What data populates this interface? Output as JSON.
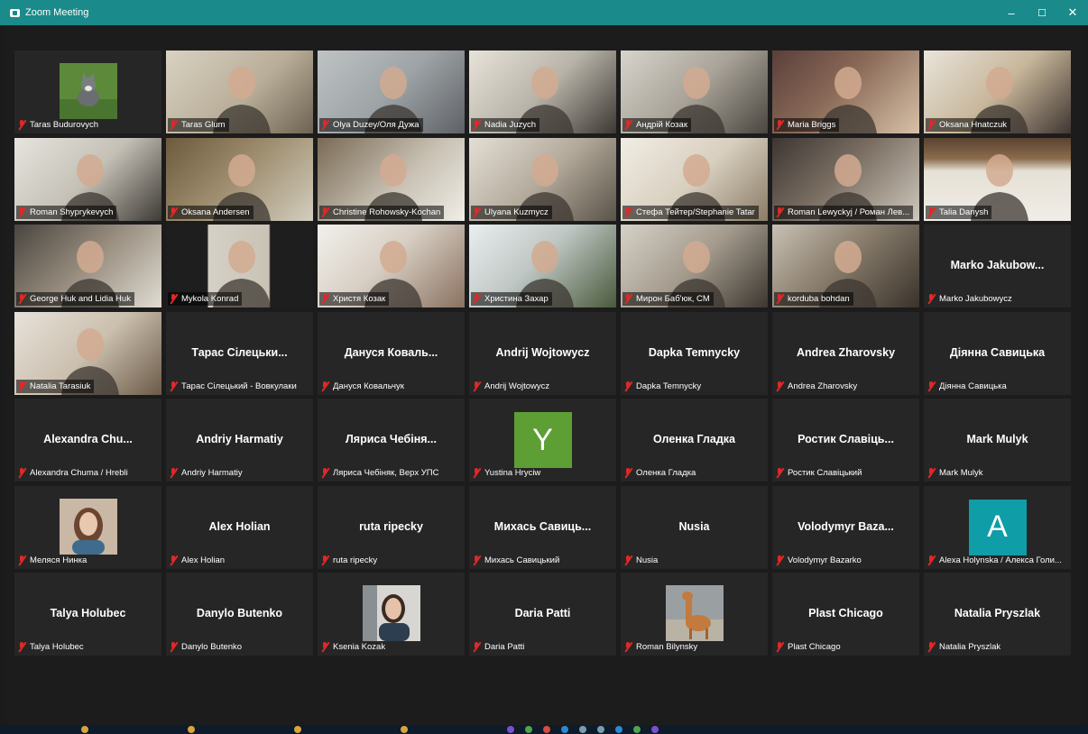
{
  "window": {
    "title": "Zoom Meeting",
    "controls": {
      "minimize": "–",
      "maximize": "☐",
      "close": "✕"
    }
  },
  "accent": "#1a8a8a",
  "active_speaker_color": "#c7e067",
  "participants": [
    {
      "name": "Taras Budurovych",
      "type": "photo",
      "bg": "#2a2a2a",
      "img": "cat"
    },
    {
      "name": "Taras Glum",
      "type": "video",
      "bg": "linear-gradient(135deg,#d9d2c2 0%,#b8ad98 55%,#6e6352 100%)"
    },
    {
      "name": "Olya Duzey/Оля Дужа",
      "type": "video",
      "bg": "linear-gradient(135deg,#bfc3c4 0%,#9da3a6 50%,#5e6165 100%)",
      "active": true
    },
    {
      "name": "Nadia Juzych",
      "type": "video",
      "bg": "linear-gradient(135deg,#e8e3da 0%,#b8b3a8 50%,#3c3833 100%)"
    },
    {
      "name": "Андрій Козак",
      "type": "video",
      "bg": "linear-gradient(135deg,#d7d4cc 0%,#a8a297 50%,#4a4640 100%)"
    },
    {
      "name": "Maria Briggs",
      "type": "video",
      "bg": "linear-gradient(135deg,#5a3f3a 0%,#8a6a58 45%,#d8c1a8 100%)"
    },
    {
      "name": "Oksana Hnatczuk",
      "type": "video",
      "bg": "linear-gradient(135deg,#e9e4db 0%,#c7b69a 50%,#403632 100%)"
    },
    {
      "name": "Roman Shyprykevych",
      "type": "video",
      "bg": "linear-gradient(135deg,#e6e4de 0%,#c4c0b6 50%,#3e3a35 100%)"
    },
    {
      "name": "Oksana Andersen",
      "type": "video",
      "bg": "linear-gradient(135deg,#6d5a3e 0%,#9c8b6c 45%,#d2cdbd 100%)"
    },
    {
      "name": "Christine Rohowsky-Kochan",
      "type": "video",
      "bg": "linear-gradient(135deg,#7a6a55 0%,#c7c0b2 55%,#f0ede6 100%)"
    },
    {
      "name": "Ulyana Kuzmycz",
      "type": "video",
      "bg": "linear-gradient(135deg,#e3ded5 0%,#b3aa9b 50%,#5a5348 100%)"
    },
    {
      "name": "Стефа Тейтер/Stephanie Tatar",
      "type": "video",
      "bg": "linear-gradient(135deg,#f1ede4 0%,#d8cfbf 50%,#8a7c66 100%)"
    },
    {
      "name": "Roman Lewyckyj / Роман Лев...",
      "type": "video",
      "bg": "linear-gradient(135deg,#3c3632 0%,#7a6e62 45%,#cfc8bd 100%)"
    },
    {
      "name": "Talia Danysh",
      "type": "video",
      "bg": "linear-gradient(180deg,#5a4330 0%,#8c6c4d 25%,#e6e1d6 40%,#f0ede8 100%)"
    },
    {
      "name": "George Huk and Lidia Huk",
      "type": "video",
      "bg": "linear-gradient(135deg,#4a4540 0%,#9a8f80 50%,#e0dcd3 100%)"
    },
    {
      "name": "Mykola Konrad",
      "type": "video",
      "bg": "linear-gradient(90deg,#1e1e1e 0%,#1e1e1e 28%,#d5d0c6 29%,#c9c2b5 70%,#1e1e1e 71%)"
    },
    {
      "name": "Христя Козак",
      "type": "video",
      "bg": "linear-gradient(135deg,#f2f0ec 0%,#d8cfc4 45%,#8a7160 100%)"
    },
    {
      "name": "Христина Захар",
      "type": "video",
      "bg": "linear-gradient(135deg,#e9eef0 0%,#bfc7c4 45%,#4a5a3c 100%)"
    },
    {
      "name": "Мирон Баб'юк, CM",
      "type": "video",
      "bg": "linear-gradient(135deg,#d6d1c8 0%,#a39a8c 50%,#3b3630 100%)"
    },
    {
      "name": "korduba bohdan",
      "type": "video",
      "bg": "linear-gradient(135deg,#c7c0b4 0%,#8a7e6d 45%,#3a332c 100%)"
    },
    {
      "name": "Marko Jakubowycz",
      "type": "text",
      "display": "Marko Jakubow..."
    },
    {
      "name": "Natalia Tarasiuk",
      "type": "video",
      "bg": "linear-gradient(135deg,#e7e2da 0%,#cbbfae 50%,#6b5a48 100%)"
    },
    {
      "name": "Тарас Сілецький - Вовкулаки",
      "type": "text",
      "display": "Тарас Сілецьки..."
    },
    {
      "name": "Дануся Ковальчук",
      "type": "text",
      "display": "Дануся Коваль..."
    },
    {
      "name": "Andrij Wojtowycz",
      "type": "text",
      "display": "Andrij Wojtowycz"
    },
    {
      "name": "Dapka Temnycky",
      "type": "text",
      "display": "Dapka Temnycky"
    },
    {
      "name": "Andrea Zharovsky",
      "type": "text",
      "display": "Andrea Zharovsky"
    },
    {
      "name": "Діянна Савицька",
      "type": "text",
      "display": "Діянна Савицька"
    },
    {
      "name": "Alexandra Chuma / Hrebli",
      "type": "text",
      "display": "Alexandra Chu..."
    },
    {
      "name": "Andriy Harmatiy",
      "type": "text",
      "display": "Andriy Harmatiy"
    },
    {
      "name": "Лярисa Чебіняк, Верх УПС",
      "type": "text",
      "display": "Ляриса Чебіня..."
    },
    {
      "name": "Yustina Hryciw",
      "type": "avatar",
      "letter": "Y",
      "color": "#5e9f35"
    },
    {
      "name": "Оленка Гладка",
      "type": "text",
      "display": "Оленка Гладка"
    },
    {
      "name": "Ростик Славіцький",
      "type": "text",
      "display": "Ростик Славіць..."
    },
    {
      "name": "Mark Mulyk",
      "type": "text",
      "display": "Mark Mulyk"
    },
    {
      "name": "Меляся Нинка",
      "type": "photo",
      "bg": "#2a2a2a",
      "img": "woman"
    },
    {
      "name": "Alex Holian",
      "type": "text",
      "display": "Alex Holian"
    },
    {
      "name": "ruta ripecky",
      "type": "text",
      "display": "ruta ripecky"
    },
    {
      "name": "Михась Савицький",
      "type": "text",
      "display": "Михась Савиць..."
    },
    {
      "name": "Nusia",
      "type": "text",
      "display": "Nusia"
    },
    {
      "name": "Volodymyr Bazarko",
      "type": "text",
      "display": "Volodymyr Baza..."
    },
    {
      "name": "Alexa Holynska / Алекса Голи...",
      "type": "avatar",
      "letter": "A",
      "color": "#0f9da8"
    },
    {
      "name": "Talya Holubec",
      "type": "text",
      "display": "Talya Holubec"
    },
    {
      "name": "Danylo Butenko",
      "type": "text",
      "display": "Danylo Butenko"
    },
    {
      "name": "Ksenia Kozak",
      "type": "photo",
      "bg": "#2a2a2a",
      "img": "woman2"
    },
    {
      "name": "Daria Patti",
      "type": "text",
      "display": "Daria Patti"
    },
    {
      "name": "Roman Bilynsky",
      "type": "photo",
      "bg": "#2a2a2a",
      "img": "llama"
    },
    {
      "name": "Plast Chicago",
      "type": "text",
      "display": "Plast Chicago"
    },
    {
      "name": "Natalia Pryszlak",
      "type": "text",
      "display": "Natalia Pryszlak"
    }
  ]
}
